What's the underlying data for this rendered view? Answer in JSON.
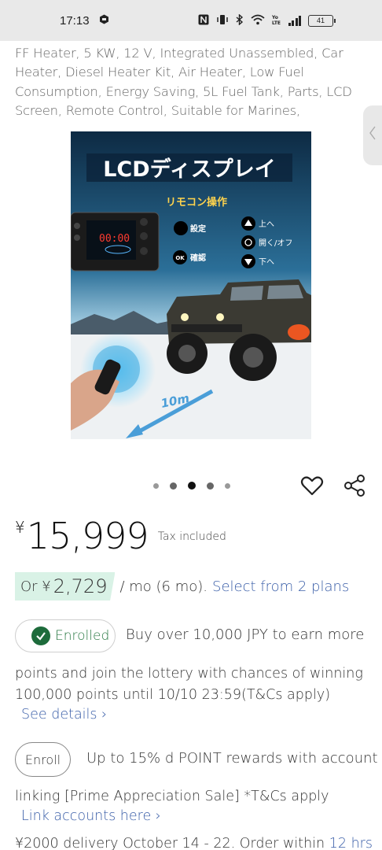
{
  "status_bar": {
    "time": "17:13",
    "battery": "41"
  },
  "product": {
    "title": "FF Heater, 5 KW, 12 V, Integrated Unassembled, Car Heater, Diesel Heater Kit, Air Heater, Low Fuel Consumption, Energy Saving, 5L Fuel Tank, Parts, LCD Screen, Remote Control, Suitable for Marines,",
    "image": {
      "headline": "LCDディスプレイ",
      "subhead": "リモコン操作",
      "display_readout": "00:00",
      "btn_setting": "設定",
      "btn_confirm": "確認",
      "btn_ok": "OK",
      "btn_up": "上へ",
      "btn_power": "開く/オフ",
      "btn_down": "下へ",
      "distance": "10m"
    },
    "carousel": {
      "count": 5,
      "active_index": 2
    }
  },
  "price": {
    "currency": "¥",
    "amount": "15,999",
    "tax_note": "Tax included"
  },
  "installment": {
    "prefix": "Or ¥",
    "amount": "2,729",
    "suffix": "/ mo (6 mo).",
    "link": "Select from 2 plans"
  },
  "points": {
    "enrolled_label": "Enrolled",
    "line1": "Buy over 10,000 JPY to earn more",
    "body": "points and join the lottery with chances of winning 100,000 points until 10/10 23:59(T&Cs apply)",
    "details_link": "See details ›"
  },
  "dpoint": {
    "enroll_label": "Enroll",
    "line1": "Up to 15% d POINT rewards with account",
    "body": "linking [Prime Appreciation Sale] *T&Cs apply",
    "link": "Link accounts here ›"
  },
  "delivery": {
    "text": "¥2000 delivery October 14 - 22. Order within",
    "highlight": "12 hrs"
  },
  "colors": {
    "link": "#3a5ea8",
    "enrolled_green": "#1d6b3b",
    "installment_bg": "#d9f2e6"
  }
}
